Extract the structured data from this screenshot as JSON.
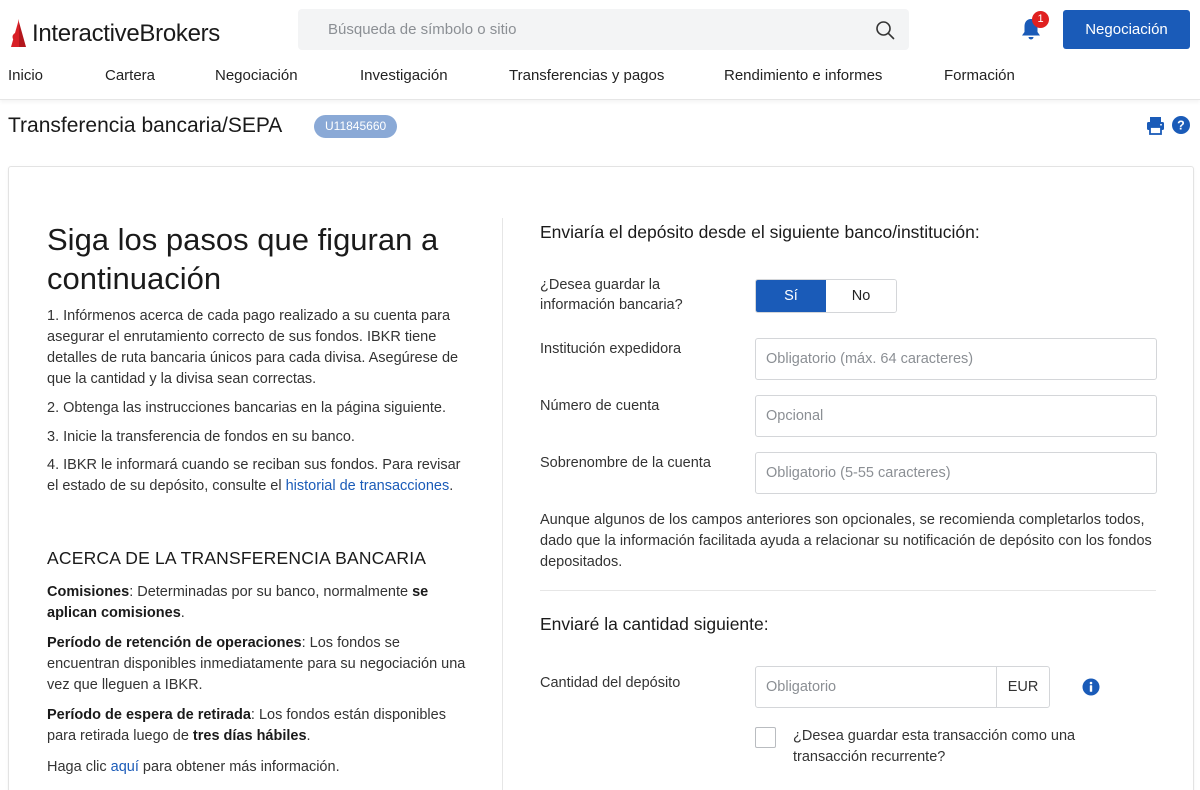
{
  "header": {
    "logo_prefix": "Interactive",
    "logo_suffix": "Brokers",
    "search_placeholder": "Búsqueda de símbolo o sitio",
    "notification_count": "1",
    "trade_button": "Negociación",
    "colors": {
      "brand_red": "#d81f26",
      "accent_blue": "#1a5bb8",
      "badge_red": "#e02020"
    }
  },
  "nav": {
    "items": [
      {
        "label": "Inicio"
      },
      {
        "label": "Cartera"
      },
      {
        "label": "Negociación"
      },
      {
        "label": "Investigación"
      },
      {
        "label": "Transferencias y pagos"
      },
      {
        "label": "Rendimiento e informes"
      },
      {
        "label": "Formación"
      }
    ]
  },
  "page": {
    "title": "Transferencia bancaria/SEPA",
    "account_id": "U11845660"
  },
  "left": {
    "heading": "Siga los pasos que figuran a continuación",
    "step1": "1. Infórmenos acerca de cada pago realizado a su cuenta para asegurar el enrutamiento correcto de sus fondos. IBKR tiene detalles de ruta bancaria únicos para cada divisa. Asegúrese de que la cantidad y la divisa sean correctas.",
    "step2": "2. Obtenga las instrucciones bancarias en la página siguiente.",
    "step3": "3. Inicie la transferencia de fondos en su banco.",
    "step4_text": "4. IBKR le informará cuando se reciban sus fondos. Para revisar el estado de su depósito, consulte el ",
    "step4_link": "historial de transacciones",
    "step4_end": ".",
    "about_heading": "ACERCA DE LA TRANSFERENCIA BANCARIA",
    "fees_label": "Comisiones",
    "fees_text": ": Determinadas por su banco, normalmente ",
    "fees_bold": "se aplican comisiones",
    "fees_end": ".",
    "hold_label": "Período de retención de operaciones",
    "hold_text": ": Los fondos se encuentran disponibles inmediatamente para su negociación una vez que lleguen a IBKR.",
    "withdraw_label": "Período de espera de retirada",
    "withdraw_text": ": Los fondos están disponibles para retirada luego de ",
    "withdraw_bold": "tres días hábiles",
    "withdraw_end": ".",
    "more_prefix": "Haga clic ",
    "more_link": "aquí",
    "more_suffix": " para obtener más información."
  },
  "right": {
    "bank_section_title": "Enviaría el depósito desde el siguiente banco/institución:",
    "save_bank_label": "¿Desea guardar la información bancaria?",
    "toggle_yes": "Sí",
    "toggle_no": "No",
    "institution_label": "Institución expedidora",
    "institution_placeholder": "Obligatorio (máx. 64 caracteres)",
    "account_number_label": "Número de cuenta",
    "account_number_placeholder": "Opcional",
    "nickname_label": "Sobrenombre de la cuenta",
    "nickname_placeholder": "Obligatorio (5-55 caracteres)",
    "note": "Aunque algunos de los campos anteriores son opcionales, se recomienda completarlos todos, dado que la información facilitada ayuda a relacionar su notificación de depósito con los fondos depositados.",
    "amount_section_title": "Enviaré la cantidad siguiente:",
    "amount_label": "Cantidad del depósito",
    "amount_placeholder": "Obligatorio",
    "currency": "EUR",
    "recurring_label": "¿Desea guardar esta transacción como una transacción recurrente?"
  },
  "icons": [
    "search-icon",
    "bell-icon",
    "print-icon",
    "help-icon",
    "info-icon"
  ]
}
